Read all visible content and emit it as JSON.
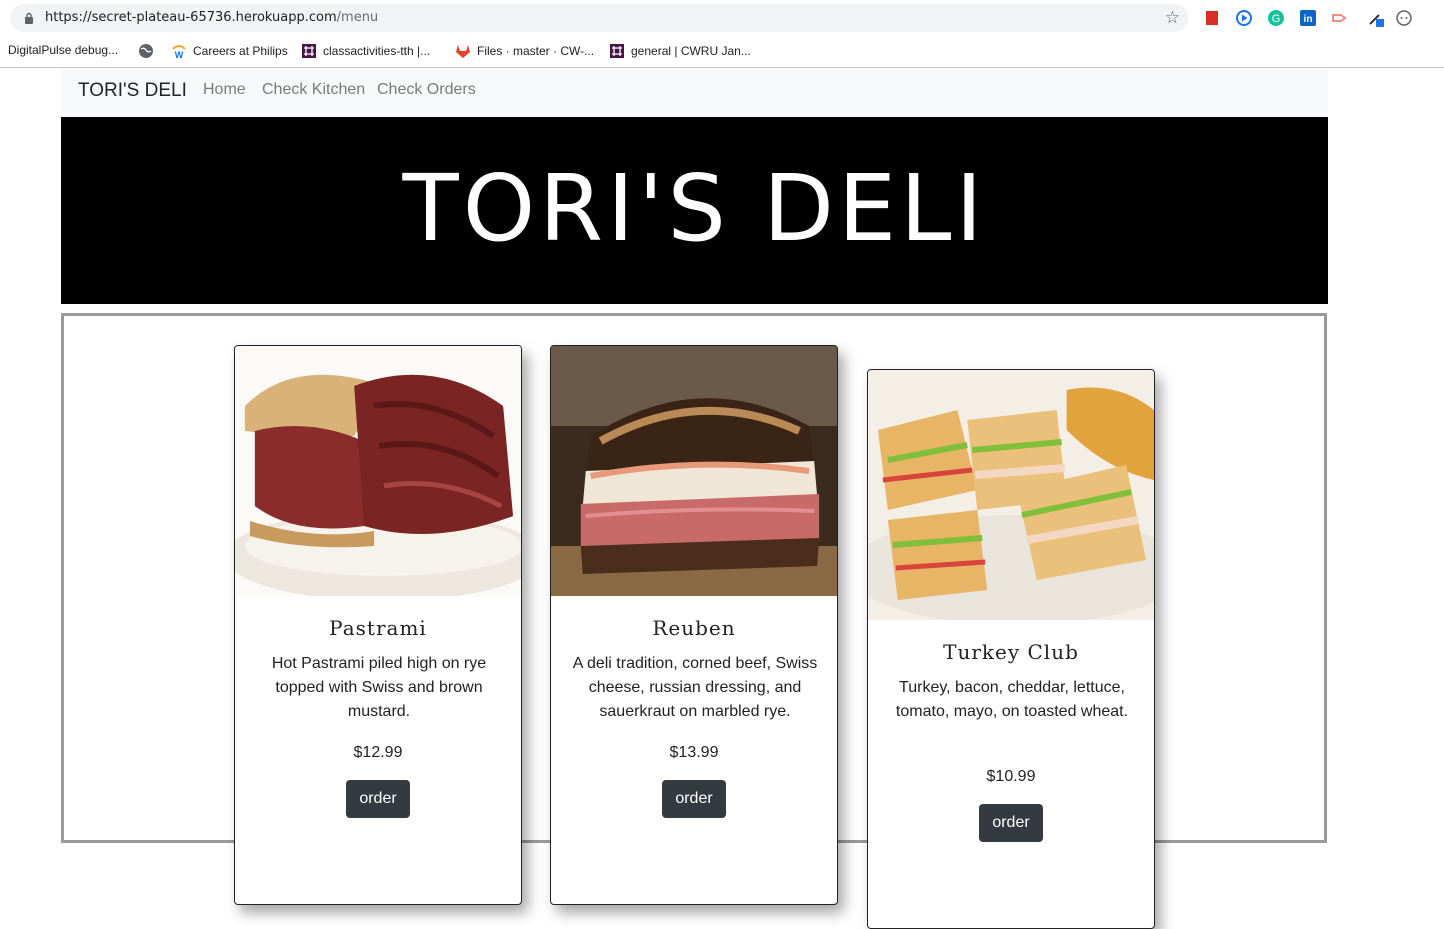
{
  "browser": {
    "url_host": "https://secret-plateau-65736.herokuapp.com",
    "url_path": "/menu",
    "bookmarks": [
      {
        "label": "DigitalPulse debug...",
        "icon": "none"
      },
      {
        "label": "",
        "icon": "globe-icon"
      },
      {
        "label": "Careers at Philips",
        "icon": "workday-icon"
      },
      {
        "label": "classactivities-tth |...",
        "icon": "slack-icon"
      },
      {
        "label": "Files · master · CW-...",
        "icon": "gitlab-icon"
      },
      {
        "label": "general | CWRU Jan...",
        "icon": "slack-icon"
      }
    ]
  },
  "nav": {
    "brand": "TORI'S DELI",
    "links": [
      "Home",
      "Check Kitchen",
      "Check Orders"
    ]
  },
  "hero": {
    "title": "TORI'S DELI"
  },
  "menu": {
    "items": [
      {
        "name": "Pastrami",
        "description": "Hot Pastrami piled high on rye topped with Swiss and brown mustard.",
        "price": "$12.99",
        "button": "order"
      },
      {
        "name": "Reuben",
        "description": "A deli tradition, corned beef, Swiss cheese, russian dressing, and sauerkraut on marbled rye.",
        "price": "$13.99",
        "button": "order"
      },
      {
        "name": "Turkey Club",
        "description": "Turkey, bacon, cheddar, lettuce, tomato, mayo, on toasted wheat.",
        "price": "$10.99",
        "button": "order"
      }
    ]
  },
  "colors": {
    "hero_bg": "#000000",
    "navbar_bg": "#f8f9fa",
    "button_bg": "#343a40"
  }
}
